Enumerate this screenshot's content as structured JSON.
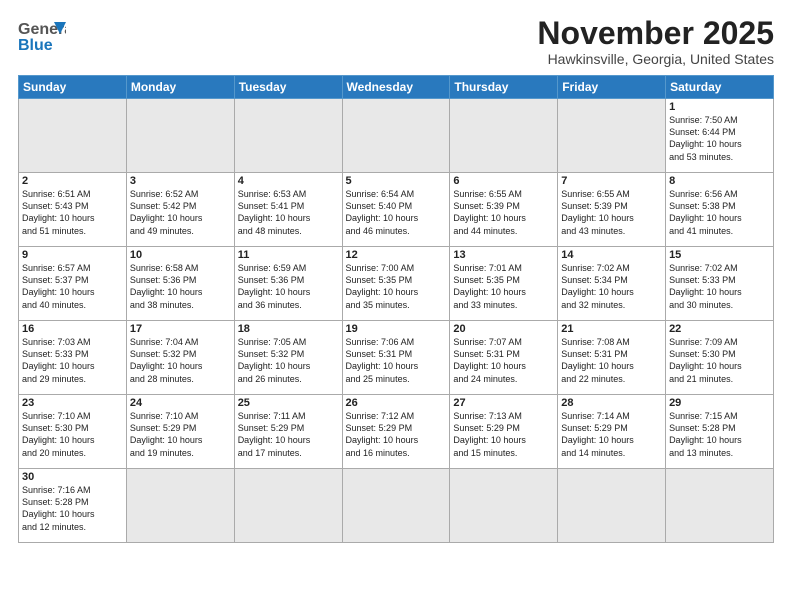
{
  "header": {
    "logo_general": "General",
    "logo_blue": "Blue",
    "month_title": "November 2025",
    "location": "Hawkinsville, Georgia, United States"
  },
  "weekdays": [
    "Sunday",
    "Monday",
    "Tuesday",
    "Wednesday",
    "Thursday",
    "Friday",
    "Saturday"
  ],
  "weeks": [
    [
      {
        "day": "",
        "info": ""
      },
      {
        "day": "",
        "info": ""
      },
      {
        "day": "",
        "info": ""
      },
      {
        "day": "",
        "info": ""
      },
      {
        "day": "",
        "info": ""
      },
      {
        "day": "",
        "info": ""
      },
      {
        "day": "1",
        "info": "Sunrise: 7:50 AM\nSunset: 6:44 PM\nDaylight: 10 hours\nand 53 minutes."
      }
    ],
    [
      {
        "day": "2",
        "info": "Sunrise: 6:51 AM\nSunset: 5:43 PM\nDaylight: 10 hours\nand 51 minutes."
      },
      {
        "day": "3",
        "info": "Sunrise: 6:52 AM\nSunset: 5:42 PM\nDaylight: 10 hours\nand 49 minutes."
      },
      {
        "day": "4",
        "info": "Sunrise: 6:53 AM\nSunset: 5:41 PM\nDaylight: 10 hours\nand 48 minutes."
      },
      {
        "day": "5",
        "info": "Sunrise: 6:54 AM\nSunset: 5:40 PM\nDaylight: 10 hours\nand 46 minutes."
      },
      {
        "day": "6",
        "info": "Sunrise: 6:55 AM\nSunset: 5:39 PM\nDaylight: 10 hours\nand 44 minutes."
      },
      {
        "day": "7",
        "info": "Sunrise: 6:55 AM\nSunset: 5:39 PM\nDaylight: 10 hours\nand 43 minutes."
      },
      {
        "day": "8",
        "info": "Sunrise: 6:56 AM\nSunset: 5:38 PM\nDaylight: 10 hours\nand 41 minutes."
      }
    ],
    [
      {
        "day": "9",
        "info": "Sunrise: 6:57 AM\nSunset: 5:37 PM\nDaylight: 10 hours\nand 40 minutes."
      },
      {
        "day": "10",
        "info": "Sunrise: 6:58 AM\nSunset: 5:36 PM\nDaylight: 10 hours\nand 38 minutes."
      },
      {
        "day": "11",
        "info": "Sunrise: 6:59 AM\nSunset: 5:36 PM\nDaylight: 10 hours\nand 36 minutes."
      },
      {
        "day": "12",
        "info": "Sunrise: 7:00 AM\nSunset: 5:35 PM\nDaylight: 10 hours\nand 35 minutes."
      },
      {
        "day": "13",
        "info": "Sunrise: 7:01 AM\nSunset: 5:35 PM\nDaylight: 10 hours\nand 33 minutes."
      },
      {
        "day": "14",
        "info": "Sunrise: 7:02 AM\nSunset: 5:34 PM\nDaylight: 10 hours\nand 32 minutes."
      },
      {
        "day": "15",
        "info": "Sunrise: 7:02 AM\nSunset: 5:33 PM\nDaylight: 10 hours\nand 30 minutes."
      }
    ],
    [
      {
        "day": "16",
        "info": "Sunrise: 7:03 AM\nSunset: 5:33 PM\nDaylight: 10 hours\nand 29 minutes."
      },
      {
        "day": "17",
        "info": "Sunrise: 7:04 AM\nSunset: 5:32 PM\nDaylight: 10 hours\nand 28 minutes."
      },
      {
        "day": "18",
        "info": "Sunrise: 7:05 AM\nSunset: 5:32 PM\nDaylight: 10 hours\nand 26 minutes."
      },
      {
        "day": "19",
        "info": "Sunrise: 7:06 AM\nSunset: 5:31 PM\nDaylight: 10 hours\nand 25 minutes."
      },
      {
        "day": "20",
        "info": "Sunrise: 7:07 AM\nSunset: 5:31 PM\nDaylight: 10 hours\nand 24 minutes."
      },
      {
        "day": "21",
        "info": "Sunrise: 7:08 AM\nSunset: 5:31 PM\nDaylight: 10 hours\nand 22 minutes."
      },
      {
        "day": "22",
        "info": "Sunrise: 7:09 AM\nSunset: 5:30 PM\nDaylight: 10 hours\nand 21 minutes."
      }
    ],
    [
      {
        "day": "23",
        "info": "Sunrise: 7:10 AM\nSunset: 5:30 PM\nDaylight: 10 hours\nand 20 minutes."
      },
      {
        "day": "24",
        "info": "Sunrise: 7:10 AM\nSunset: 5:29 PM\nDaylight: 10 hours\nand 19 minutes."
      },
      {
        "day": "25",
        "info": "Sunrise: 7:11 AM\nSunset: 5:29 PM\nDaylight: 10 hours\nand 17 minutes."
      },
      {
        "day": "26",
        "info": "Sunrise: 7:12 AM\nSunset: 5:29 PM\nDaylight: 10 hours\nand 16 minutes."
      },
      {
        "day": "27",
        "info": "Sunrise: 7:13 AM\nSunset: 5:29 PM\nDaylight: 10 hours\nand 15 minutes."
      },
      {
        "day": "28",
        "info": "Sunrise: 7:14 AM\nSunset: 5:29 PM\nDaylight: 10 hours\nand 14 minutes."
      },
      {
        "day": "29",
        "info": "Sunrise: 7:15 AM\nSunset: 5:28 PM\nDaylight: 10 hours\nand 13 minutes."
      }
    ],
    [
      {
        "day": "30",
        "info": "Sunrise: 7:16 AM\nSunset: 5:28 PM\nDaylight: 10 hours\nand 12 minutes."
      },
      {
        "day": "",
        "info": ""
      },
      {
        "day": "",
        "info": ""
      },
      {
        "day": "",
        "info": ""
      },
      {
        "day": "",
        "info": ""
      },
      {
        "day": "",
        "info": ""
      },
      {
        "day": "",
        "info": ""
      }
    ]
  ]
}
